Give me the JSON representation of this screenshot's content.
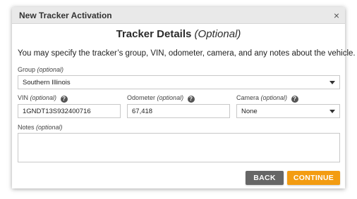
{
  "dialog": {
    "title": "New Tracker Activation",
    "close_icon": "×"
  },
  "heading": {
    "main": "Tracker Details",
    "optional": "(Optional)"
  },
  "intro": "You may specify the tracker’s group, VIN, odometer, camera, and any notes about the vehicle.",
  "fields": {
    "group": {
      "label": "Group",
      "optional": "(optional)",
      "value": "Southern Illinois"
    },
    "vin": {
      "label": "VIN",
      "optional": "(optional)",
      "value": "1GNDT13S932400716"
    },
    "odometer": {
      "label": "Odometer",
      "optional": "(optional)",
      "value": "67,418"
    },
    "camera": {
      "label": "Camera",
      "optional": "(optional)",
      "value": "None"
    },
    "notes": {
      "label": "Notes",
      "optional": "(optional)",
      "value": ""
    }
  },
  "help_icon": "?",
  "buttons": {
    "back": "BACK",
    "continue": "CONTINUE"
  },
  "colors": {
    "back": "#666666",
    "continue": "#f39c12"
  }
}
